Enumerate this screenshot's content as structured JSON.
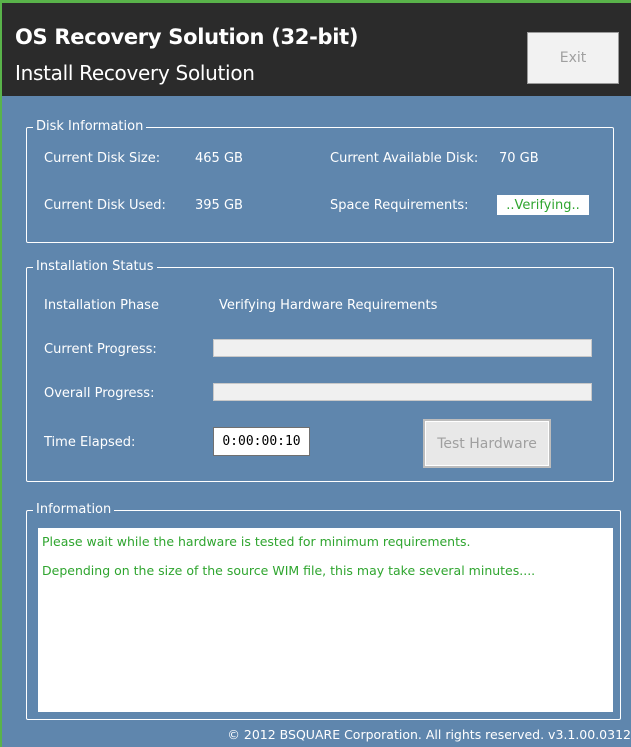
{
  "header": {
    "title": "OS Recovery Solution (32-bit)",
    "subtitle": "Install Recovery Solution",
    "exit_label": "Exit"
  },
  "disk_info": {
    "legend": "Disk Information",
    "current_size_label": "Current Disk Size:",
    "current_size_value": "465 GB",
    "current_used_label": "Current Disk Used:",
    "current_used_value": "395 GB",
    "available_label": "Current Available Disk:",
    "available_value": "70 GB",
    "space_req_label": "Space Requirements:",
    "space_req_value": "..Verifying.."
  },
  "install_status": {
    "legend": "Installation Status",
    "phase_label": "Installation Phase",
    "phase_value": "Verifying Hardware Requirements",
    "current_progress_label": "Current Progress:",
    "current_progress_percent": 0,
    "overall_progress_label": "Overall Progress:",
    "overall_progress_percent": 0,
    "time_elapsed_label": "Time Elapsed:",
    "time_elapsed_value": "0:00:00:10",
    "test_hardware_label": "Test Hardware"
  },
  "information": {
    "legend": "Information",
    "lines": [
      "Please wait while the hardware is tested for minimum requirements.",
      "Depending on the size of the source WIM file, this may take several minutes...."
    ]
  },
  "footer": {
    "copyright": "© 2012 BSQUARE Corporation. All rights reserved. v3.1.00.0312"
  },
  "colors": {
    "background": "#5f86ad",
    "header": "#2b2b2b",
    "accent_green": "#59b34a",
    "status_text_green": "#2fa52f"
  }
}
